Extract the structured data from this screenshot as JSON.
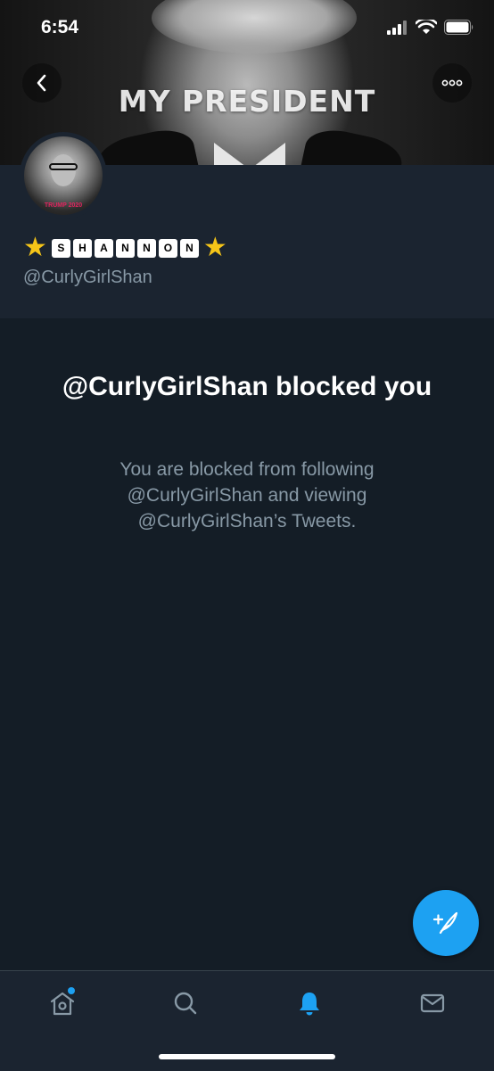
{
  "status_bar": {
    "time": "6:54"
  },
  "header": {
    "banner_text": "MY PRESIDENT"
  },
  "profile": {
    "name_letters": [
      "S",
      "H",
      "A",
      "N",
      "N",
      "O",
      "N"
    ],
    "handle": "@CurlyGirlShan",
    "avatar_text": "TRUMP 2020"
  },
  "blocked": {
    "title": "@CurlyGirlShan blocked you",
    "description": "You are blocked from following @CurlyGirlShan and viewing @CurlyGirlShan’s Tweets."
  },
  "icons": {
    "back": "chevron-left-icon",
    "more": "more-horizontal-icon",
    "compose": "compose-tweet-icon",
    "home": "home-icon",
    "search": "search-icon",
    "notifications": "bell-icon",
    "messages": "mail-icon",
    "star": "star-emoji-icon"
  },
  "colors": {
    "accent": "#1da1f2",
    "background": "#141d26",
    "secondary_text": "#8899a6"
  }
}
